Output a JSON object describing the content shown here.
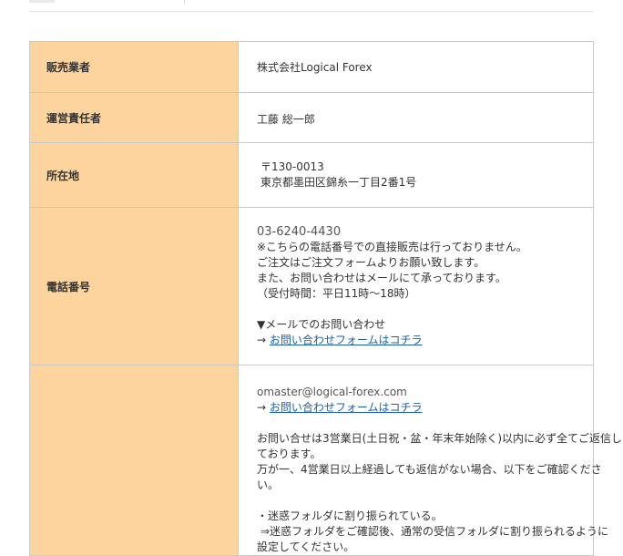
{
  "rows": [
    {
      "label": "販売業者",
      "value": "株式会社Logical Forex"
    },
    {
      "label": "運営責任者",
      "value": "工藤 総一郎"
    },
    {
      "label": "所在地",
      "postal": "〒130-0013",
      "address": "東京都墨田区錦糸一丁目2番1号"
    },
    {
      "label": "電話番号",
      "phone": "03-6240-4430",
      "lines": [
        "※こちらの電話番号での直接販売は行っておりません。",
        "ご注文はご注文フォームよりお願い致します。",
        "また、お問い合わせはメールにて承っております。",
        "（受付時間：平日11時〜18時）"
      ],
      "mail_heading": "▼メールでのお問い合わせ",
      "arrow": "→",
      "contact_link": "お問い合わせフォームはコチラ"
    },
    {
      "label": "",
      "email": "omaster@logical-forex.com",
      "arrow": "→",
      "contact_link": "お問い合わせフォームはコチラ",
      "lines": [
        "お問い合せは3営業日(土日祝・盆・年末年始除く)以内に必ず全てご返信し",
        "ております。",
        "万が一、4営業日以上経過しても返信がない場合、以下をご確認くださ",
        "い。"
      ],
      "bullet": "・迷惑フォルダに割り振られている。",
      "bullet_sub": "⇒迷惑フォルダをご確認後、通常の受信フォルダに割り振られるように",
      "bullet_sub2": "設定してください。"
    }
  ]
}
